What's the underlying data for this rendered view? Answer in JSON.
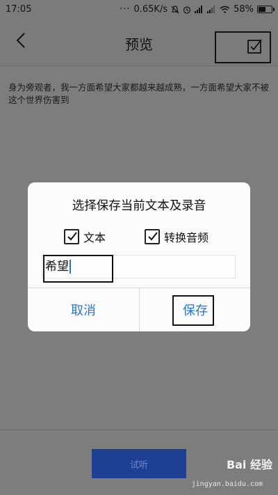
{
  "status_bar": {
    "time": "17:05",
    "dots": "···",
    "speed": "0.65K/s",
    "battery": "58%",
    "battery_level": 0.58
  },
  "header": {
    "title": "预览"
  },
  "preview": {
    "text": "身为旁观者，我一方面希望大家都越来越成熟，一方面希望大家不被这个世界伤害到"
  },
  "dialog": {
    "title": "选择保存当前文本及录音",
    "options": [
      {
        "label": "文本",
        "checked": true
      },
      {
        "label": "转换音频",
        "checked": true
      }
    ],
    "input_value": "希望",
    "cancel_label": "取消",
    "save_label": "保存"
  },
  "bottom": {
    "listen_label": "试听"
  },
  "watermark": {
    "brand": "Bai 经验",
    "url": "jingyan.baidu.com"
  },
  "colors": {
    "accent": "#2a73c9",
    "button_bg": "#1f3f93",
    "overlay": "#7d7d7d"
  }
}
